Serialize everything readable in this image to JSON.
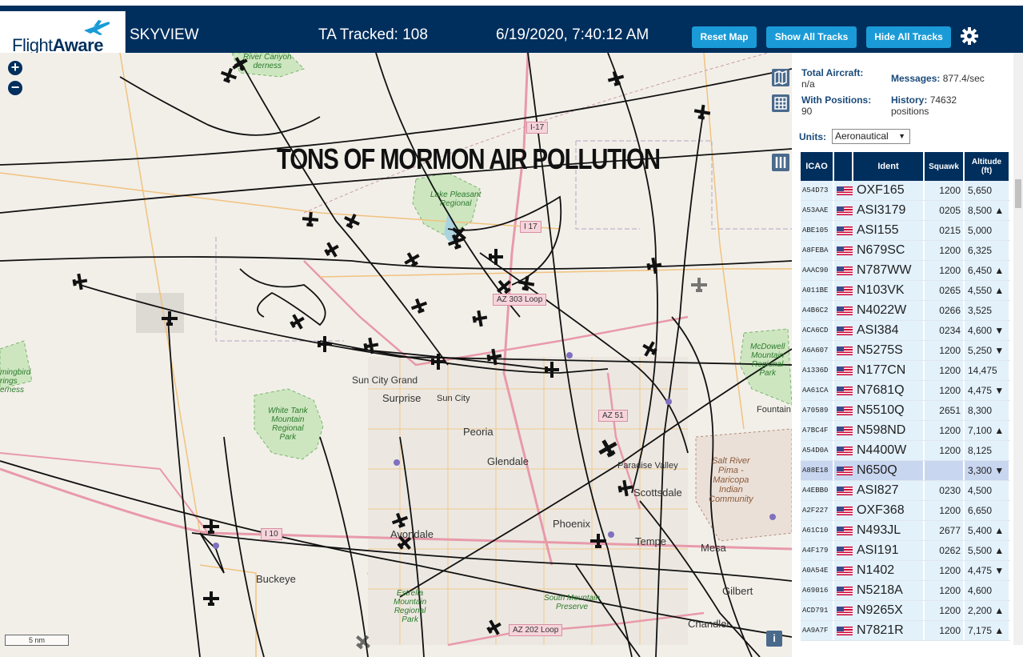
{
  "header": {
    "logo_text_a": "Flight",
    "logo_text_b": "Aware",
    "app_name": "SKYVIEW",
    "tracked": "TA Tracked: 108",
    "datetime": "6/19/2020, 7:40:12 AM",
    "reset_label": "Reset Map",
    "show_label": "Show All Tracks",
    "hide_label": "Hide All Tracks"
  },
  "map": {
    "overlay_title": "TONS OF MORMON AIR POLLUTION",
    "zoom_in": "+",
    "zoom_out": "−",
    "scale": "5 nm",
    "info": "i",
    "labels": {
      "suncity_grand": "Sun City Grand",
      "surprise": "Surprise",
      "sun_city": "Sun City",
      "peoria": "Peoria",
      "glendale": "Glendale",
      "paradise": "Paradise Valley",
      "scottsdale": "Scottsdale",
      "avondale": "Avondale",
      "phoenix": "Phoenix",
      "tempe": "Tempe",
      "mesa": "Mesa",
      "buckeye": "Buckeye",
      "gilbert": "Gilbert",
      "chandler": "Chandler",
      "fountain": "Fountain"
    },
    "parks": {
      "white_tank": "White Tank\nMountain\nRegional\nPark",
      "lake_pleasant": "Lake Pleasant\nRegional",
      "mcdowell": "McDowell\nMountain\nRegional\nPark",
      "estrella": "Estrella\nMountain\nRegional\nPark",
      "south_mountain": "South Mountain\nPreserve",
      "hummingbird": "mingbird\nrings\nerness",
      "river_canyon": "River Canyon\nderness"
    },
    "tribal": "Salt River\nPima -\nMaricopa\nIndian\nCommunity",
    "shields": {
      "i17a": "I-17",
      "i17b": "I 17",
      "az303": "AZ 303 Loop",
      "az51": "AZ 51",
      "i10": "I 10",
      "az202": "AZ 202 Loop"
    }
  },
  "sidebar": {
    "total_aircraft_label": "Total Aircraft:",
    "total_aircraft_value": "n/a",
    "with_positions_label": "With Positions:",
    "with_positions_value": "90",
    "messages_label": "Messages:",
    "messages_value": "877.4/sec",
    "history_label": "History:",
    "history_value": "74632",
    "history_unit": "positions",
    "units_label": "Units:",
    "units_value": "Aeronautical"
  },
  "table": {
    "headers": {
      "icao": "ICAO",
      "ident": "Ident",
      "squawk": "Squawk",
      "alt_a": "Altitude",
      "alt_b": "(ft)"
    },
    "rows": [
      {
        "icao": "A54D73",
        "ident": "OXF165",
        "squawk": "1200",
        "alt": "5,650"
      },
      {
        "icao": "A53AAE",
        "ident": "ASI3179",
        "squawk": "0205",
        "alt": "8,500 ▲"
      },
      {
        "icao": "ABE105",
        "ident": "ASI155",
        "squawk": "0215",
        "alt": "5,000"
      },
      {
        "icao": "A8FEBA",
        "ident": "N679SC",
        "squawk": "1200",
        "alt": "6,325"
      },
      {
        "icao": "AAAC90",
        "ident": "N787WW",
        "squawk": "1200",
        "alt": "6,450 ▲"
      },
      {
        "icao": "A011BE",
        "ident": "N103VK",
        "squawk": "0265",
        "alt": "4,550 ▲"
      },
      {
        "icao": "A4B6C2",
        "ident": "N4022W",
        "squawk": "0266",
        "alt": "3,525"
      },
      {
        "icao": "ACA6CD",
        "ident": "ASI384",
        "squawk": "0234",
        "alt": "4,600 ▼"
      },
      {
        "icao": "A6A607",
        "ident": "N5275S",
        "squawk": "1200",
        "alt": "5,250 ▼"
      },
      {
        "icao": "A1336D",
        "ident": "N177CN",
        "squawk": "1200",
        "alt": "14,475"
      },
      {
        "icao": "AA61CA",
        "ident": "N7681Q",
        "squawk": "1200",
        "alt": "4,475 ▼"
      },
      {
        "icao": "A70589",
        "ident": "N5510Q",
        "squawk": "2651",
        "alt": "8,300"
      },
      {
        "icao": "A7BC4F",
        "ident": "N598ND",
        "squawk": "1200",
        "alt": "7,100 ▲"
      },
      {
        "icao": "A54D0A",
        "ident": "N4400W",
        "squawk": "1200",
        "alt": "8,125"
      },
      {
        "icao": "A88E18",
        "ident": "N650Q",
        "squawk": "",
        "alt": "3,300 ▼",
        "selected": true
      },
      {
        "icao": "A4EBB0",
        "ident": "ASI827",
        "squawk": "0230",
        "alt": "4,500"
      },
      {
        "icao": "A2F227",
        "ident": "OXF368",
        "squawk": "1200",
        "alt": "6,650"
      },
      {
        "icao": "A61C10",
        "ident": "N493JL",
        "squawk": "2677",
        "alt": "5,400 ▲"
      },
      {
        "icao": "A4F179",
        "ident": "ASI191",
        "squawk": "0262",
        "alt": "5,500 ▲"
      },
      {
        "icao": "A0A54E",
        "ident": "N1402",
        "squawk": "1200",
        "alt": "4,475 ▼"
      },
      {
        "icao": "A69016",
        "ident": "N5218A",
        "squawk": "1200",
        "alt": "4,600"
      },
      {
        "icao": "ACD791",
        "ident": "N9265X",
        "squawk": "1200",
        "alt": "2,200 ▲"
      },
      {
        "icao": "AA9A7F",
        "ident": "N7821R",
        "squawk": "1200",
        "alt": "7,175 ▲"
      }
    ]
  }
}
